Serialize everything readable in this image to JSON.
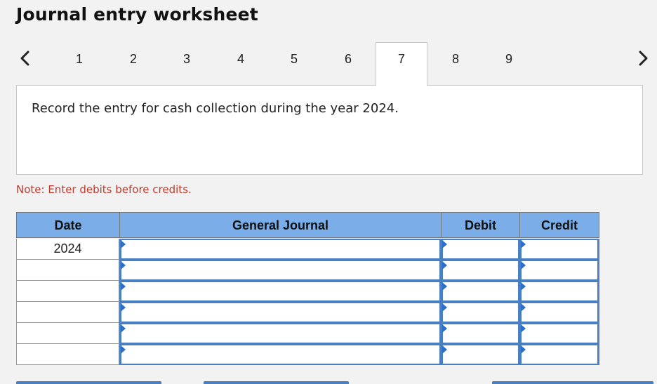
{
  "page": {
    "title": "Journal entry worksheet"
  },
  "tabs": [
    {
      "label": "1",
      "active": false
    },
    {
      "label": "2",
      "active": false
    },
    {
      "label": "3",
      "active": false
    },
    {
      "label": "4",
      "active": false
    },
    {
      "label": "5",
      "active": false
    },
    {
      "label": "6",
      "active": false
    },
    {
      "label": "7",
      "active": true
    },
    {
      "label": "8",
      "active": false
    },
    {
      "label": "9",
      "active": false
    }
  ],
  "nav": {
    "prev_icon": "chevron-left-icon",
    "next_icon": "chevron-right-icon"
  },
  "question": {
    "text": "Record the entry for cash collection during the year 2024."
  },
  "note": {
    "text": "Note: Enter debits before credits."
  },
  "journal": {
    "headers": {
      "date": "Date",
      "general_journal": "General Journal",
      "debit": "Debit",
      "credit": "Credit"
    },
    "rows": [
      {
        "date": "2024",
        "account": "",
        "debit": "",
        "credit": ""
      },
      {
        "date": "",
        "account": "",
        "debit": "",
        "credit": ""
      },
      {
        "date": "",
        "account": "",
        "debit": "",
        "credit": ""
      },
      {
        "date": "",
        "account": "",
        "debit": "",
        "credit": ""
      },
      {
        "date": "",
        "account": "",
        "debit": "",
        "credit": ""
      },
      {
        "date": "",
        "account": "",
        "debit": "",
        "credit": ""
      }
    ]
  },
  "colors": {
    "header_bg": "#7baee8",
    "input_border": "#4a7fc1",
    "note_text": "#c0392b",
    "page_bg": "#f2f2f2"
  }
}
